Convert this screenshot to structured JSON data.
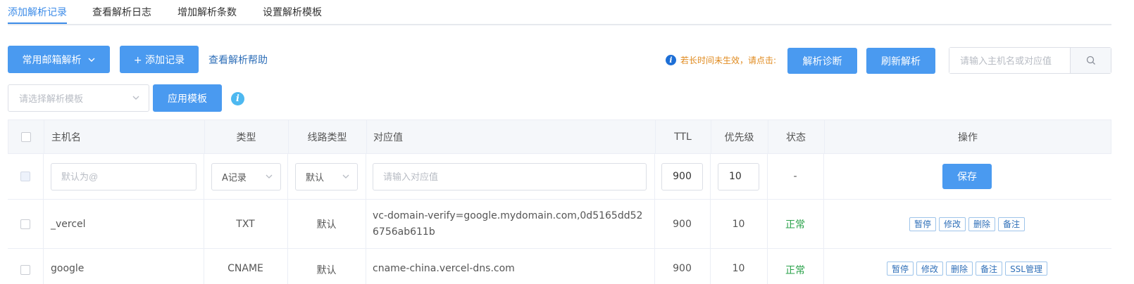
{
  "tabs": [
    {
      "label": "添加解析记录"
    },
    {
      "label": "查看解析日志"
    },
    {
      "label": "增加解析条数"
    },
    {
      "label": "设置解析模板"
    }
  ],
  "toolbar": {
    "mail_parse_label": "常用邮箱解析",
    "add_record_label": "+ 添加记录",
    "help_link": "查看解析帮助",
    "hint_text": "若长时间未生效，请点击:",
    "diagnose_label": "解析诊断",
    "refresh_label": "刷新解析",
    "search_placeholder": "请输入主机名或对应值"
  },
  "template": {
    "select_placeholder": "请选择解析模板",
    "apply_label": "应用模板"
  },
  "table": {
    "headers": {
      "host": "主机名",
      "type": "类型",
      "line": "线路类型",
      "value": "对应值",
      "ttl": "TTL",
      "priority": "优先级",
      "status": "状态",
      "actions": "操作"
    },
    "edit_row": {
      "host_placeholder": "默认为@",
      "type_value": "A记录",
      "line_value": "默认",
      "value_placeholder": "请输入对应值",
      "ttl": "900",
      "priority": "10",
      "status": "-",
      "save_label": "保存"
    },
    "rows": [
      {
        "host": "_vercel",
        "type": "TXT",
        "line": "默认",
        "value": "vc-domain-verify=google.mydomain.com,0d5165dd526756ab611b",
        "ttl": "900",
        "priority": "10",
        "status": "正常",
        "actions": [
          "暂停",
          "修改",
          "删除",
          "备注"
        ]
      },
      {
        "host": "google",
        "type": "CNAME",
        "line": "默认",
        "value": "cname-china.vercel-dns.com",
        "ttl": "900",
        "priority": "10",
        "status": "正常",
        "actions": [
          "暂停",
          "修改",
          "删除",
          "备注",
          "SSL管理"
        ]
      }
    ]
  },
  "colors": {
    "primary": "#4a9af0",
    "link": "#2f6fb8",
    "status_ok": "#2aa24a",
    "hint": "#e08a1e"
  }
}
